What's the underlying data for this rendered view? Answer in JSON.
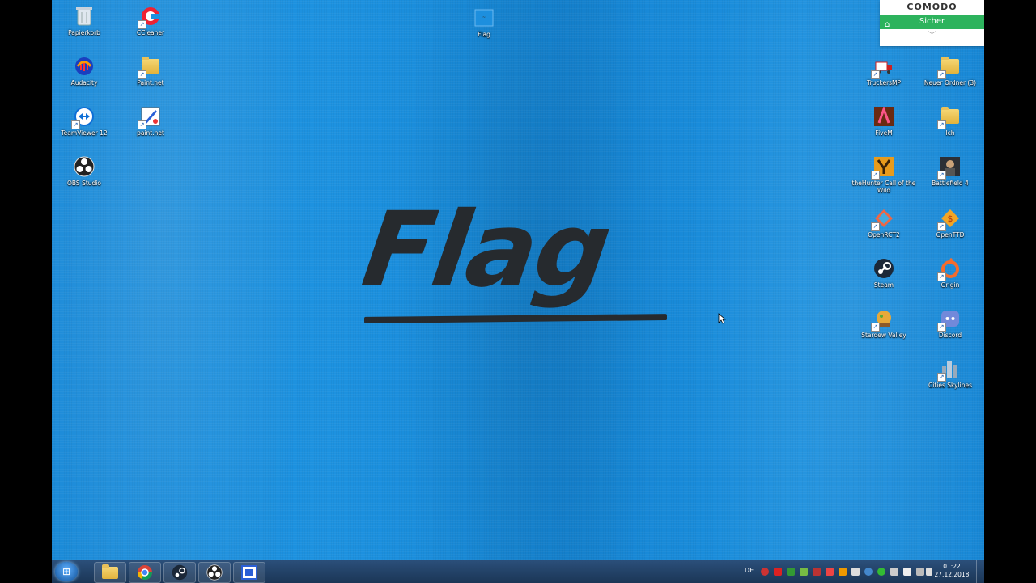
{
  "desktop": {
    "icons_left": [
      {
        "label": "Papierkorb",
        "icon": "recycle-bin-icon"
      },
      {
        "label": "CCleaner",
        "icon": "ccleaner-icon"
      },
      {
        "label": "Audacity",
        "icon": "audacity-icon"
      },
      {
        "label": "Paint.net",
        "icon": "folder-icon"
      },
      {
        "label": "TeamViewer 12",
        "icon": "teamviewer-icon"
      },
      {
        "label": "paint.net",
        "icon": "paintnet-icon"
      },
      {
        "label": "OBS Studio",
        "icon": "obs-icon"
      }
    ],
    "icon_center": {
      "label": "Flag",
      "icon": "image-file-icon"
    },
    "icons_right": [
      {
        "label": "TruckersMP",
        "icon": "truckersmp-icon"
      },
      {
        "label": "Neuer Ordner (3)",
        "icon": "folder-icon"
      },
      {
        "label": "FiveM",
        "icon": "fivem-icon"
      },
      {
        "label": "Ich",
        "icon": "folder-icon"
      },
      {
        "label": "theHunter Call of the Wild",
        "icon": "thehunter-icon"
      },
      {
        "label": "Battlefield 4",
        "icon": "battlefield-icon"
      },
      {
        "label": "OpenRCT2",
        "icon": "openrct2-icon"
      },
      {
        "label": "OpenTTD",
        "icon": "openttd-icon"
      },
      {
        "label": "Steam",
        "icon": "steam-icon"
      },
      {
        "label": "Origin",
        "icon": "origin-icon"
      },
      {
        "label": "Stardew Valley",
        "icon": "stardew-icon"
      },
      {
        "label": "Discord",
        "icon": "discord-icon"
      },
      {
        "label": "Cities Skylines",
        "icon": "cities-skylines-icon"
      }
    ],
    "wallpaper_text": "Flag"
  },
  "comodo": {
    "brand": "COMODO",
    "status": "Sicher"
  },
  "taskbar": {
    "pinned": [
      "explorer-icon",
      "chrome-icon",
      "steam-icon",
      "obs-icon",
      "remote-desktop-icon"
    ],
    "language": "DE",
    "time": "01:22",
    "date": "27.12.2018"
  },
  "colors": {
    "desktop": "#1a8ad8",
    "taskbar": "#1b3656",
    "comodo_green": "#2db35d",
    "flag_text": "#262a2e"
  }
}
